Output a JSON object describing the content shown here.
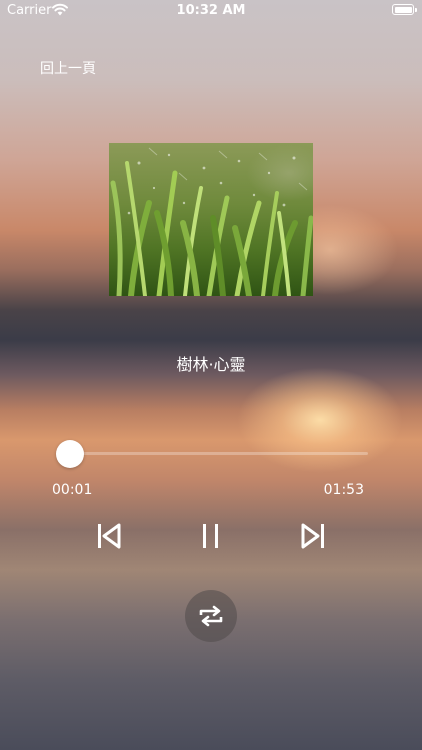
{
  "status_bar": {
    "carrier": "Carrier",
    "time": "10:32 AM",
    "icons": [
      "wifi-icon",
      "battery-icon"
    ]
  },
  "navigation": {
    "back_label": "回上一頁"
  },
  "track": {
    "title": "樹林·心靈",
    "artwork": "grass-with-water-droplets"
  },
  "playback": {
    "elapsed": "00:01",
    "total": "01:53",
    "progress_fraction": 0.009
  },
  "controls": {
    "previous_icon": "skip-previous-icon",
    "pause_icon": "pause-icon",
    "next_icon": "skip-next-icon",
    "repeat_icon": "repeat-icon"
  },
  "colors": {
    "text": "#ffffff",
    "repeat_button_bg": "#504b4b"
  }
}
